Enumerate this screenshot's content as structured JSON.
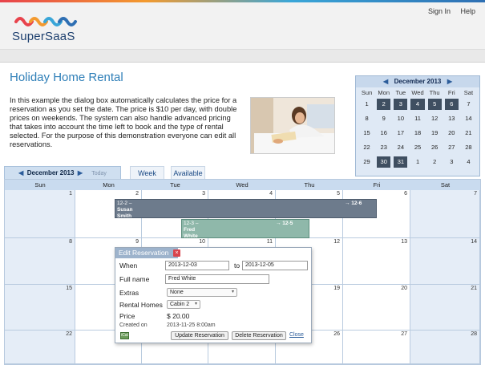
{
  "header": {
    "brand": "SuperSaaS",
    "links": {
      "sign_in": "Sign In",
      "help": "Help"
    }
  },
  "page": {
    "title": "Holiday Home Rental",
    "description": "In this example the dialog box automatically calculates the price for a reservation as you set the date. The price is $10 per day, with double prices on weekends. The system can also handle advanced pricing that takes into account the time left to book and the type of rental selected. For the purpose of this demonstration everyone can edit all reservations."
  },
  "mini_calendar": {
    "month": "December 2013",
    "prev": "◀",
    "next": "▶",
    "dows": [
      "Sun",
      "Mon",
      "Tue",
      "Wed",
      "Thu",
      "Fri",
      "Sat"
    ],
    "weeks": [
      [
        "1",
        "2",
        "3",
        "4",
        "5",
        "6",
        "7"
      ],
      [
        "8",
        "9",
        "10",
        "11",
        "12",
        "13",
        "14"
      ],
      [
        "15",
        "16",
        "17",
        "18",
        "19",
        "20",
        "21"
      ],
      [
        "22",
        "23",
        "24",
        "25",
        "26",
        "27",
        "28"
      ],
      [
        "29",
        "30",
        "31",
        "1",
        "2",
        "3",
        "4"
      ]
    ]
  },
  "tabs": {
    "month_label": "December 2013",
    "prev": "◀",
    "next": "▶",
    "today": "Today",
    "week": "Week",
    "available": "Available"
  },
  "month_grid": {
    "dows": [
      "Sun",
      "Mon",
      "Tue",
      "Wed",
      "Thu",
      "Fri",
      "Sat"
    ],
    "weeks": [
      [
        "1",
        "2",
        "3",
        "4",
        "5",
        "6",
        "7"
      ],
      [
        "8",
        "9",
        "10",
        "11",
        "12",
        "13",
        "14"
      ],
      [
        "15",
        "16",
        "17",
        "18",
        "19",
        "20",
        "21"
      ],
      [
        "22",
        "23",
        "24",
        "25",
        "26",
        "27",
        "28"
      ]
    ]
  },
  "reservations": {
    "r1": {
      "start": "12-2 –",
      "end": "→ 12-6",
      "name_first": "Susan",
      "name_last": "Smith"
    },
    "r2": {
      "start": "12-3 –",
      "end": "→ 12-5",
      "name_first": "Fred",
      "name_last": "White"
    }
  },
  "dialog": {
    "title": "Edit Reservation",
    "close_glyph": "×",
    "when_label": "When",
    "from": "2013-12-03",
    "to_label": "to",
    "to": "2013-12-05",
    "fullname_label": "Full name",
    "fullname": "Fred White",
    "extras_label": "Extras",
    "extras_value": "None",
    "homes_label": "Rental Homes",
    "homes_value": "Cabin 2",
    "price_label": "Price",
    "price_value": "$ 20.00",
    "created_label": "Created on",
    "created_value": "2013-11-25 8:00am",
    "ical": "iCal",
    "update_button": "Update Reservation",
    "delete_button": "Delete Reservation",
    "close_link": "Close"
  }
}
